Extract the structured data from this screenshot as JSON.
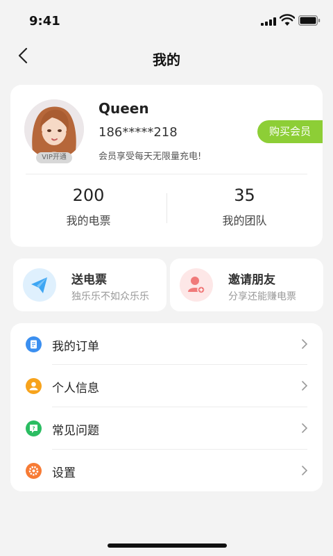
{
  "status_bar": {
    "time": "9:41"
  },
  "nav": {
    "title": "我的"
  },
  "profile": {
    "name": "Queen",
    "phone": "186*****218",
    "member_note": "会员享受每天无限量充电!",
    "vip_badge": "VIP开通",
    "buy_button": "购买会员",
    "stats": [
      {
        "value": "200",
        "label": "我的电票"
      },
      {
        "value": "35",
        "label": "我的团队"
      }
    ]
  },
  "actions": [
    {
      "title": "送电票",
      "subtitle": "独乐乐不如众乐乐",
      "icon": "paper-plane-icon",
      "color": "#3ea6f3"
    },
    {
      "title": "邀请朋友",
      "subtitle": "分享还能赚电票",
      "icon": "add-user-icon",
      "color": "#f07a7a"
    }
  ],
  "menu": {
    "items": [
      {
        "label": "我的订单",
        "icon": "order-icon",
        "color": "#3b8ff0"
      },
      {
        "label": "个人信息",
        "icon": "profile-icon",
        "color": "#f7a31c"
      },
      {
        "label": "常见问题",
        "icon": "faq-icon",
        "color": "#2bbd62"
      },
      {
        "label": "设置",
        "icon": "settings-icon",
        "color": "#f77b35"
      }
    ]
  },
  "colors": {
    "accent": "#8dce36",
    "background": "#f3f3f3"
  }
}
